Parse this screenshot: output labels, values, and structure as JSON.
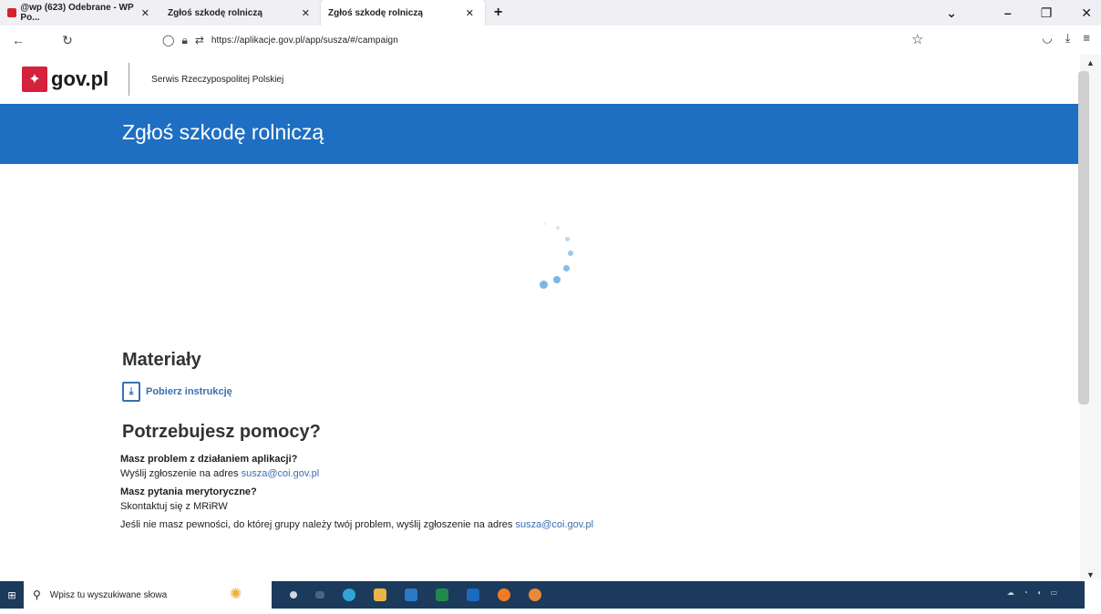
{
  "browser": {
    "tabs": [
      {
        "label": "@wp (623) Odebrane - WP Po..."
      },
      {
        "label": "Zgłoś szkodę rolniczą"
      },
      {
        "label": "Zgłoś szkodę rolniczą"
      }
    ],
    "close_glyph": "✕",
    "new_tab_glyph": "+",
    "url": "https://aplikacje.gov.pl/app/susza/#/campaign"
  },
  "site": {
    "logo_text": "gov.pl",
    "service_name": "Serwis Rzeczypospolitej Polskiej",
    "banner_title": "Zgłoś szkodę rolniczą"
  },
  "content": {
    "materials_heading": "Materiały",
    "download_link": "Pobierz instrukcję",
    "help_heading": "Potrzebujesz pomocy?",
    "q1": "Masz problem z działaniem aplikacji?",
    "q1_answer_prefix": "Wyślij zgłoszenie na adres ",
    "q1_email": "susza@coi.gov.pl",
    "q2": "Masz pytania merytoryczne?",
    "q2_answer": "Skontaktuj się z MRiRW",
    "note_prefix": "Jeśli nie masz pewności, do której grupy należy twój problem, wyślij zgłoszenie na adres ",
    "note_email": "susza@coi.gov.pl"
  },
  "taskbar": {
    "search_placeholder": "Wpisz tu wyszukiwane słowa"
  },
  "colors": {
    "banner": "#1e6fc2",
    "link": "#3a6fb0",
    "taskbar": "#1b3a5c",
    "spinner": "#7bb5ea"
  }
}
